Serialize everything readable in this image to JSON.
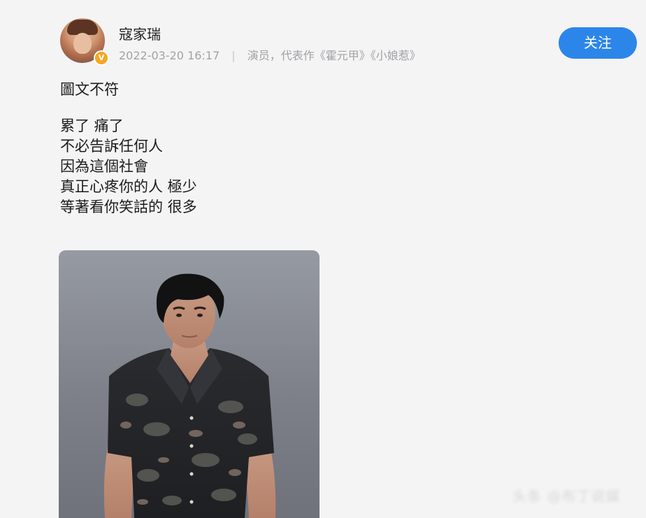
{
  "author": {
    "name": "寇家瑞",
    "verified_badge": "V"
  },
  "post": {
    "timestamp": "2022-03-20 16:17",
    "separator": "|",
    "description": "演员，代表作《霍元甲》《小娘惹》",
    "follow_label": "关注",
    "intro": "圖文不符",
    "lines": [
      "累了 痛了",
      "不必告訴任何人",
      "因為這個社會",
      "真正心疼你的人 極少",
      "等著看你笑話的 很多"
    ]
  },
  "watermark": "头条 @布丁说娱",
  "colors": {
    "accent": "#2c86e9",
    "badge": "#f6a623",
    "meta_text": "#a2a2a6",
    "background": "#f4f4f5"
  },
  "icons": {
    "verified": "verified-badge-icon"
  }
}
